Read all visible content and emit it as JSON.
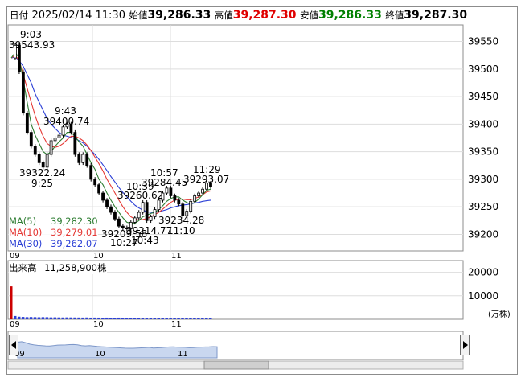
{
  "header": {
    "date_label": "日付",
    "datetime": "2025/02/14 11:30",
    "open_label": "始値",
    "open_value": "39,286.33",
    "high_label": "高値",
    "high_value": "39,287.30",
    "low_label": "安値",
    "low_value": "39,286.33",
    "close_label": "終値",
    "close_value": "39,287.30"
  },
  "price_axis": [
    "39550",
    "39500",
    "39450",
    "39400",
    "39350",
    "39300",
    "39250",
    "39200"
  ],
  "time_labels": [
    "09",
    "10",
    "11"
  ],
  "annotations": {
    "a1_time": "9:03",
    "a1_price": "39543.93",
    "a2_time": "9:43",
    "a2_price": "39400.74",
    "a3_price": "39322.24",
    "a3_time": "9:25",
    "a4_time": "10:39",
    "a4_price": "39260.62",
    "a5_time": "10:57",
    "a5_price": "39284.45",
    "a6_time": "11:29",
    "a6_price": "39293.07",
    "a7_price": "39234.28",
    "a7_time": "11:10",
    "a8_price": "39214.77",
    "a8_time": "10:43",
    "a9_price": "39209.58",
    "a9_time": "10:27"
  },
  "legend": {
    "ma5_label": "MA(5)",
    "ma5_value": "39,282.30",
    "ma10_label": "MA(10)",
    "ma10_value": "39,279.01",
    "ma30_label": "MA(30)",
    "ma30_value": "39,262.07"
  },
  "colors": {
    "up": "#e00000",
    "down": "#008000",
    "ma5": "#2e7d32",
    "ma10": "#e53935",
    "ma30": "#2b3fd6",
    "volume": "#2b3fd6"
  },
  "volume": {
    "title": "出来高",
    "value": "11,258,900株",
    "axis": [
      "20000",
      "10000"
    ],
    "unit": "(万株)"
  },
  "navigator": {
    "time_labels": [
      "09",
      "10",
      "11"
    ]
  },
  "chart_data": {
    "type": "line",
    "title": "",
    "xlabel": "",
    "ylabel": "",
    "ylim": [
      39170,
      39580
    ],
    "x": [
      "9:00",
      "9:03",
      "9:06",
      "9:09",
      "9:12",
      "9:15",
      "9:18",
      "9:21",
      "9:25",
      "9:28",
      "9:31",
      "9:34",
      "9:37",
      "9:40",
      "9:43",
      "9:46",
      "9:49",
      "9:52",
      "9:55",
      "9:58",
      "10:01",
      "10:04",
      "10:07",
      "10:10",
      "10:13",
      "10:16",
      "10:19",
      "10:22",
      "10:25",
      "10:27",
      "10:30",
      "10:33",
      "10:36",
      "10:39",
      "10:43",
      "10:46",
      "10:49",
      "10:52",
      "10:55",
      "10:57",
      "11:00",
      "11:03",
      "11:06",
      "11:10",
      "11:13",
      "11:16",
      "11:19",
      "11:22",
      "11:25",
      "11:29",
      "11:30"
    ],
    "series": [
      {
        "name": "",
        "values": [
          39520,
          39543,
          39495,
          39420,
          39385,
          39360,
          39345,
          39330,
          39322,
          39345,
          39370,
          39375,
          39380,
          39395,
          39400,
          39385,
          39345,
          39330,
          39345,
          39325,
          39300,
          39290,
          39275,
          39262,
          39250,
          39240,
          39228,
          39215,
          39212,
          39210,
          39222,
          39230,
          39240,
          39258,
          39225,
          39232,
          39245,
          39262,
          39275,
          39284,
          39270,
          39262,
          39255,
          39234,
          39242,
          39260,
          39270,
          39275,
          39282,
          39293,
          39287
        ]
      },
      {
        "name": "MA(5)",
        "values": [
          39520,
          39530,
          39520,
          39480,
          39440,
          39400,
          39380,
          39365,
          39350,
          39345,
          39350,
          39360,
          39368,
          39375,
          39385,
          39385,
          39378,
          39368,
          39360,
          39345,
          39330,
          39318,
          39300,
          39290,
          39275,
          39262,
          39250,
          39240,
          39230,
          39222,
          39220,
          39220,
          39225,
          39232,
          39235,
          39238,
          39240,
          39245,
          39252,
          39260,
          39265,
          39268,
          39268,
          39262,
          39258,
          39255,
          39258,
          39264,
          39272,
          39280,
          39282
        ]
      },
      {
        "name": "MA(10)",
        "values": [
          39520,
          39525,
          39515,
          39490,
          39465,
          39440,
          39415,
          39395,
          39378,
          39365,
          39360,
          39358,
          39360,
          39365,
          39372,
          39378,
          39378,
          39375,
          39370,
          39362,
          39352,
          39340,
          39328,
          39315,
          39300,
          39288,
          39275,
          39262,
          39250,
          39240,
          39232,
          39228,
          39226,
          39227,
          39229,
          39232,
          39236,
          39240,
          39246,
          39252,
          39258,
          39262,
          39264,
          39264,
          39263,
          39263,
          39265,
          39268,
          39272,
          39277,
          39279
        ]
      },
      {
        "name": "MA(30)",
        "values": [
          39520,
          39522,
          39515,
          39505,
          39490,
          39475,
          39455,
          39440,
          39425,
          39410,
          39400,
          39392,
          39385,
          39380,
          39378,
          39376,
          39374,
          39370,
          39366,
          39360,
          39352,
          39345,
          39336,
          39326,
          39316,
          39305,
          39295,
          39285,
          39276,
          39268,
          39260,
          39253,
          39248,
          39244,
          39241,
          39240,
          39240,
          39241,
          39243,
          39245,
          39248,
          39250,
          39252,
          39253,
          39254,
          39255,
          39257,
          39258,
          39260,
          39261,
          39262
        ]
      }
    ]
  }
}
